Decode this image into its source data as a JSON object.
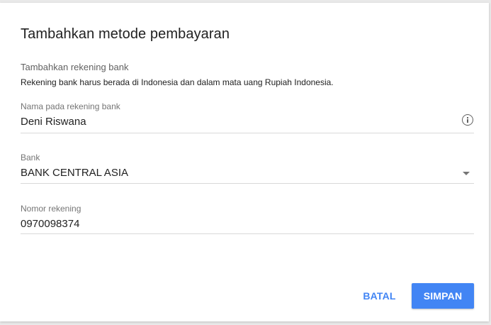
{
  "dialog": {
    "title": "Tambahkan metode pembayaran",
    "section_title": "Tambahkan rekening bank",
    "section_description": "Rekening bank harus berada di Indonesia dan dalam mata uang Rupiah Indonesia."
  },
  "fields": {
    "account_name": {
      "label": "Nama pada rekening bank",
      "value": "Deni Riswana",
      "icon": "info-icon"
    },
    "bank": {
      "label": "Bank",
      "value": "BANK CENTRAL ASIA",
      "icon": "dropdown-caret-icon"
    },
    "account_number": {
      "label": "Nomor rekening",
      "value": "0970098374"
    }
  },
  "actions": {
    "cancel_label": "BATAL",
    "save_label": "SIMPAN"
  },
  "colors": {
    "accent": "#4285f4",
    "text_primary": "#212121",
    "text_secondary": "#757575",
    "divider": "#d9d9d9"
  }
}
